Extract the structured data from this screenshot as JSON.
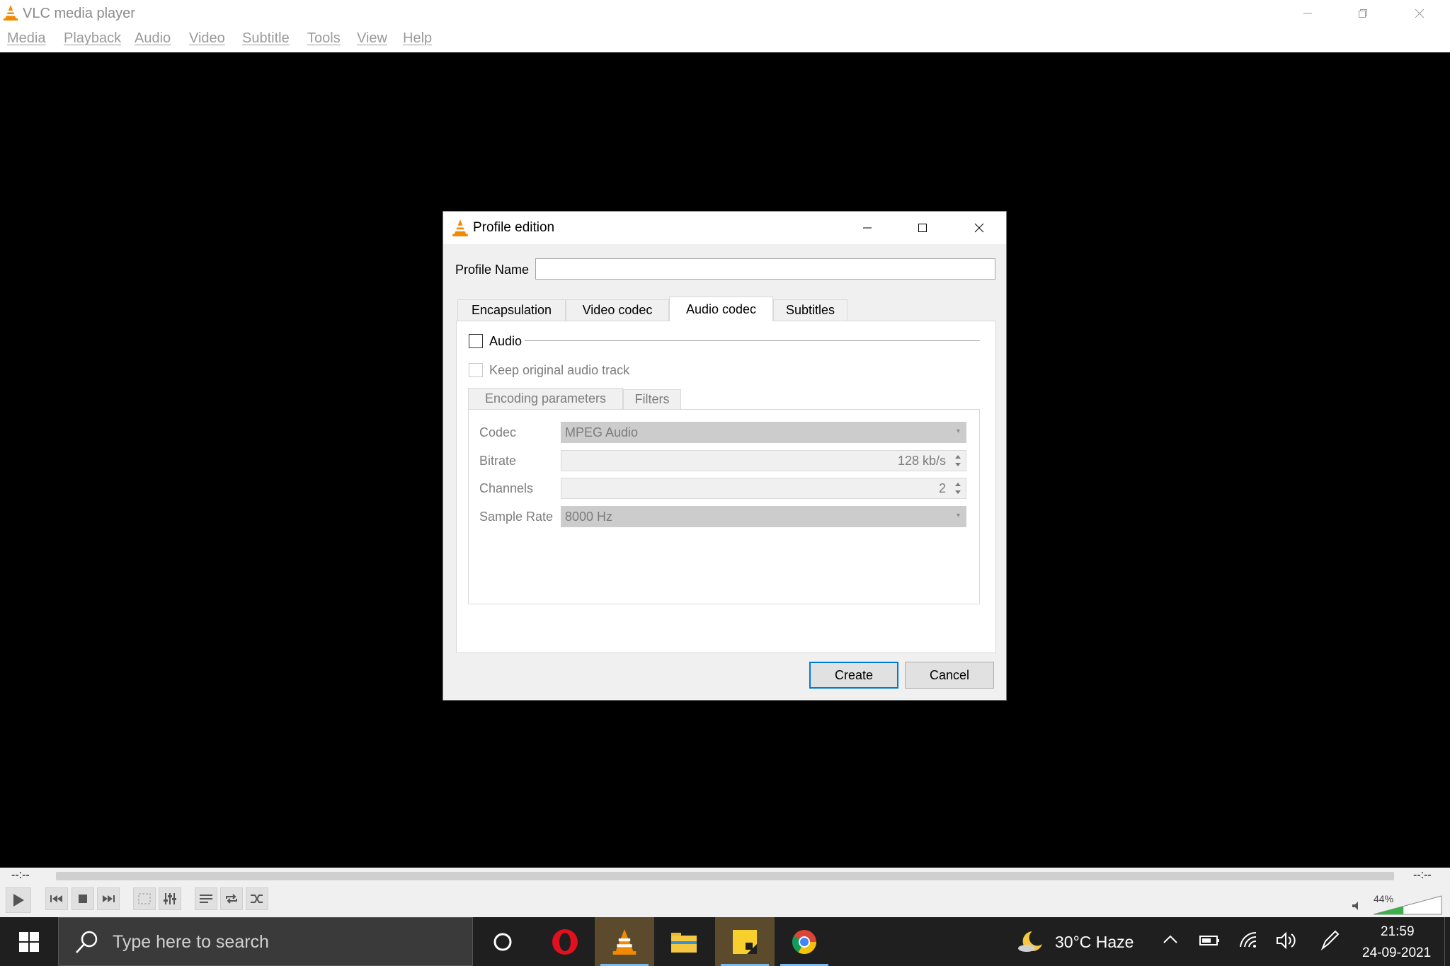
{
  "window": {
    "title": "VLC media player"
  },
  "menu": [
    "Media",
    "Playback",
    "Audio",
    "Video",
    "Subtitle",
    "Tools",
    "View",
    "Help"
  ],
  "dialog": {
    "title": "Profile edition",
    "profile_name_label": "Profile Name",
    "profile_name_value": "",
    "tabs": [
      "Encapsulation",
      "Video codec",
      "Audio codec",
      "Subtitles"
    ],
    "active_tab": "Audio codec",
    "audio_checkbox_label": "Audio",
    "audio_checked": false,
    "keep_original_label": "Keep original audio track",
    "keep_original_checked": false,
    "subtabs": [
      "Encoding parameters",
      "Filters"
    ],
    "fields": {
      "codec_label": "Codec",
      "codec_value": "MPEG Audio",
      "bitrate_label": "Bitrate",
      "bitrate_value": "128 kb/s",
      "channels_label": "Channels",
      "channels_value": "2",
      "sample_rate_label": "Sample Rate",
      "sample_rate_value": "8000 Hz"
    },
    "create_label": "Create",
    "cancel_label": "Cancel"
  },
  "player": {
    "elapsed": "--:--",
    "remaining": "--:--",
    "volume_percent": "44%",
    "volume_level": 0.44
  },
  "taskbar": {
    "search_placeholder": "Type here to search",
    "weather": "30°C  Haze",
    "time": "21:59",
    "date": "24-09-2021",
    "apps": [
      "cortana-icon",
      "opera-icon",
      "vlc-icon",
      "file-explorer-icon",
      "sticky-notes-icon",
      "chrome-icon"
    ]
  },
  "colors": {
    "vlc_orange": "#f08a00",
    "focus_blue": "#0078d7",
    "taskbar_bg": "#1f1f1f"
  }
}
